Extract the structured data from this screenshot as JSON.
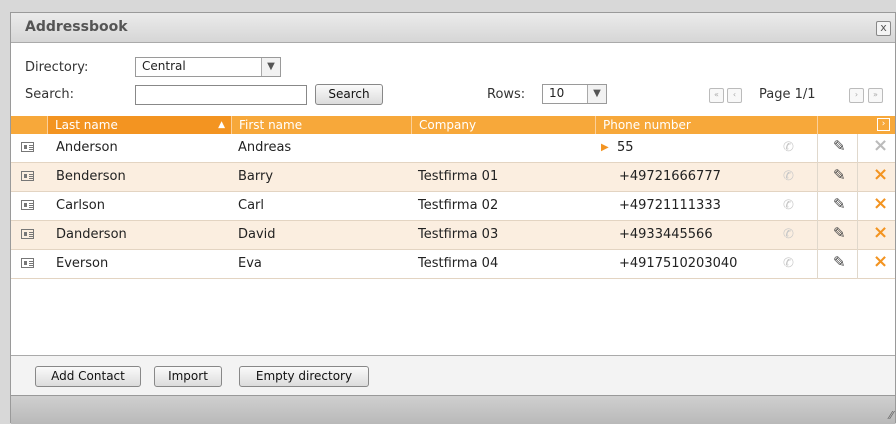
{
  "window": {
    "title": "Addressbook",
    "close_label": "x"
  },
  "controls": {
    "directory_label": "Directory:",
    "directory_value": "Central",
    "search_label": "Search:",
    "search_value": "",
    "search_button": "Search",
    "rows_label": "Rows:",
    "rows_value": "10",
    "page_label": "Page 1/1"
  },
  "table": {
    "columns": [
      "Last name",
      "First name",
      "Company",
      "Phone number"
    ],
    "sorted_column": "Last name",
    "sort_direction": "ascending",
    "rows": [
      {
        "last": "Anderson",
        "first": "Andreas",
        "company": "",
        "phone": "55",
        "selected_phone": true,
        "delete_active": false
      },
      {
        "last": "Benderson",
        "first": "Barry",
        "company": "Testfirma 01",
        "phone": "+49721666777",
        "selected_phone": false,
        "delete_active": true
      },
      {
        "last": "Carlson",
        "first": "Carl",
        "company": "Testfirma 02",
        "phone": "+49721111333",
        "selected_phone": false,
        "delete_active": true
      },
      {
        "last": "Danderson",
        "first": "David",
        "company": "Testfirma 03",
        "phone": "+4933445566",
        "selected_phone": false,
        "delete_active": true
      },
      {
        "last": "Everson",
        "first": "Eva",
        "company": "Testfirma 04",
        "phone": "+4917510203040",
        "selected_phone": false,
        "delete_active": true
      }
    ]
  },
  "footer": {
    "add_contact": "Add Contact",
    "import": "Import",
    "empty_directory": "Empty directory"
  },
  "icons": {
    "contact_card": "card-icon",
    "call": "phone-icon",
    "edit": "pencil-icon",
    "delete": "x-icon"
  },
  "colors": {
    "header_orange": "#f7a83a",
    "sorted_header": "#f39421",
    "row_alt": "#fbeee0",
    "delete_active": "#f39421",
    "delete_inactive": "#bbbbbb"
  }
}
